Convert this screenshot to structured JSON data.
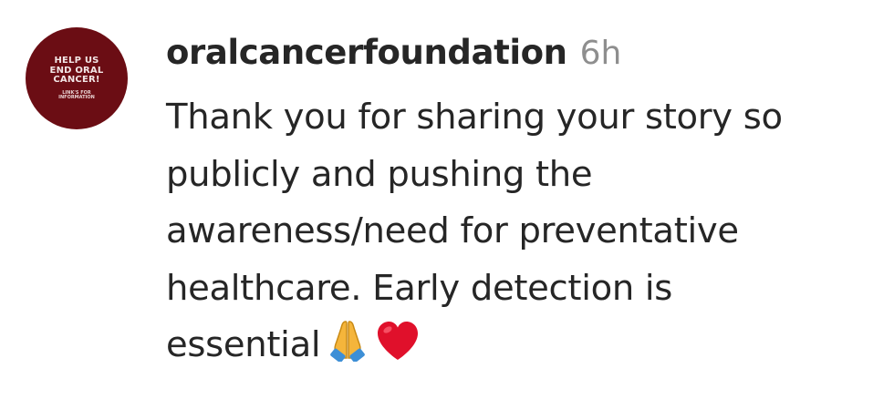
{
  "comment": {
    "avatar": {
      "line1": "HELP US",
      "line2": "END ORAL",
      "line3": "CANCER!",
      "line4": "LINK'S FOR",
      "line5": "INFORMATION"
    },
    "username": "oralcancerfoundation",
    "timestamp": "6h",
    "text_lines": [
      "Thank you for sharing your story so",
      "publicly and pushing the",
      "awareness/need for preventative",
      "healthcare. Early detection is",
      "essential"
    ],
    "emojis": [
      "folded-hands-icon",
      "red-heart-icon"
    ],
    "colors": {
      "text": "#262626",
      "timestamp": "#8e8e8e",
      "avatar_bg": "#6b0d14",
      "heart": "#e0102b",
      "hands": "#f5b53b"
    }
  }
}
